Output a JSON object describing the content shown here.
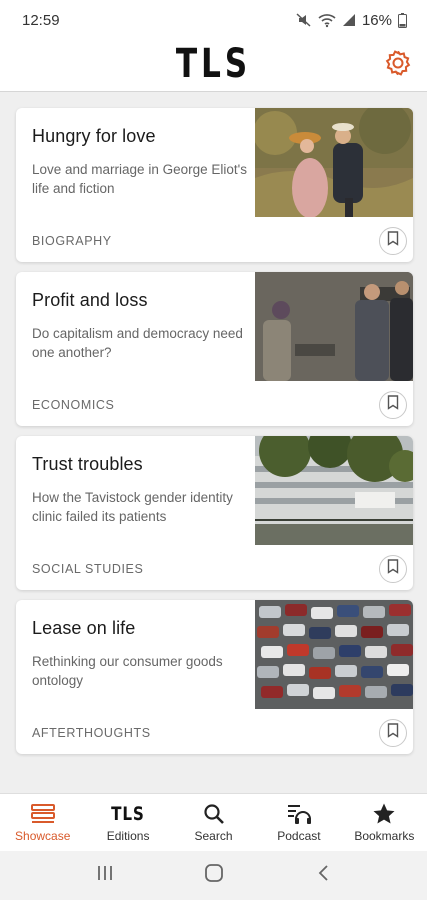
{
  "status": {
    "time": "12:59",
    "battery": "16%"
  },
  "header": {
    "logo": "TLS",
    "settings_icon": "gear-icon"
  },
  "articles": [
    {
      "title": "Hungry for love",
      "subtitle": "Love and marriage in George Eliot's life and fiction",
      "category": "BIOGRAPHY",
      "image": "painting of a courting couple"
    },
    {
      "title": "Profit and loss",
      "subtitle": "Do capitalism and democracy need one another?",
      "category": "ECONOMICS",
      "image": "people at a cash machine"
    },
    {
      "title": "Trust troubles",
      "subtitle": "How the Tavistock gender identity clinic failed its patients",
      "category": "SOCIAL STUDIES",
      "image": "clinic building behind trees"
    },
    {
      "title": "Lease on life",
      "subtitle": "Rethinking our consumer goods ontology",
      "category": "AFTERTHOUGHTS",
      "image": "car park full of cars"
    }
  ],
  "nav": [
    {
      "label": "Showcase",
      "icon": "showcase-icon",
      "active": true
    },
    {
      "label": "Editions",
      "icon": "tls-icon",
      "active": false
    },
    {
      "label": "Search",
      "icon": "search-icon",
      "active": false
    },
    {
      "label": "Podcast",
      "icon": "podcast-icon",
      "active": false
    },
    {
      "label": "Bookmarks",
      "icon": "star-icon",
      "active": false
    }
  ],
  "nav_editions_logo": "TLS",
  "colors": {
    "accent": "#d95a2b",
    "background": "#efefef",
    "card": "#ffffff"
  }
}
